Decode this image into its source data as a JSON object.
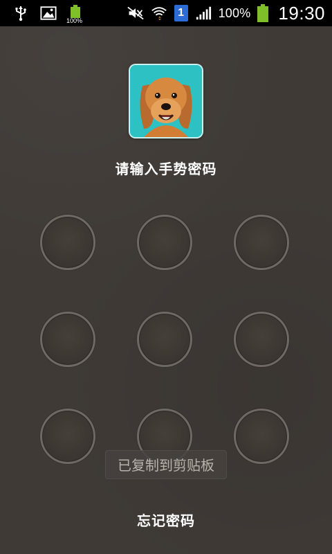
{
  "status_bar": {
    "left_icons": [
      "usb-icon",
      "image-icon",
      "battery-small-icon"
    ],
    "battery_small_label": "100%",
    "sim_slot": "1",
    "battery_percent": "100%",
    "time": "19:30",
    "colors": {
      "background": "#000000",
      "battery": "#7fbf2a",
      "sim": "#2d6bd6"
    }
  },
  "lock_screen": {
    "prompt": "请输入手势密码",
    "forgot_password": "忘记密码",
    "toast": "已复制到剪贴板",
    "avatar_icon": "dog-avatar",
    "pattern_dots": 9,
    "colors": {
      "background": "#3f3a36",
      "dot_ring": "#6f6964",
      "text": "#ffffff",
      "avatar_bg": "#2ec1c3"
    }
  }
}
